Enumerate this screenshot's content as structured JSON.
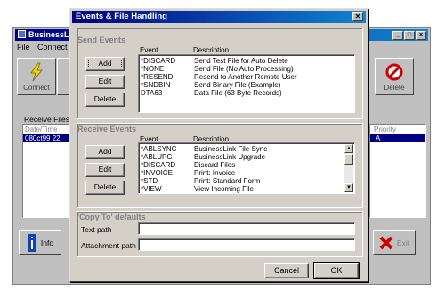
{
  "main_window": {
    "title": "BusinessLi",
    "menu": [
      "File",
      "Connect"
    ],
    "connect_label": "Connect",
    "delete_label": "Delete",
    "receive_files_label": "Receive Files",
    "date_time_header": "Date/Time",
    "priority_header": "Priority",
    "selected_row_date": "080ct99  22",
    "selected_row_priority": "A",
    "info_label": "Info",
    "exit_label": "Exit"
  },
  "dialog": {
    "title": "Events & File Handling",
    "close_glyph": "✕",
    "send_events": {
      "title": "Send Events",
      "col_event": "Event",
      "col_description": "Description",
      "buttons": {
        "add": "Add",
        "edit": "Edit",
        "delete": "Delete"
      },
      "rows": [
        {
          "event": "*DISCARD",
          "description": "Send Test File for Auto Delete"
        },
        {
          "event": "*NONE",
          "description": "Send File (No Auto Processing)"
        },
        {
          "event": "*RESEND",
          "description": "Resend to Another Remote User"
        },
        {
          "event": "*SNDBIN",
          "description": "Send Binary File (Example)"
        },
        {
          "event": "DTA63",
          "description": "Data File (63 Byte Records)"
        }
      ]
    },
    "receive_events": {
      "title": "Receive Events",
      "col_event": "Event",
      "col_description": "Description",
      "buttons": {
        "add": "Add",
        "edit": "Edit",
        "delete": "Delete"
      },
      "rows": [
        {
          "event": "*ABLSYNC",
          "description": "BusinessLink File Sync"
        },
        {
          "event": "*ABLUPG",
          "description": "BusinessLink Upgrade"
        },
        {
          "event": "*DISCARD",
          "description": "Discard Files"
        },
        {
          "event": "*INVOICE",
          "description": "Print: Invoice"
        },
        {
          "event": "*STD",
          "description": "Print: Standard Form"
        },
        {
          "event": "*VIEW",
          "description": "View Incoming File"
        }
      ]
    },
    "copy_to": {
      "title": "'Copy To' defaults",
      "text_path_label": "Text path",
      "text_path_value": "",
      "attachment_path_label": "Attachment path",
      "attachment_path_value": ""
    },
    "cancel_label": "Cancel",
    "ok_label": "OK"
  },
  "colors": {
    "titlebar_start": "#000080",
    "titlebar_end": "#1084d0",
    "face": "#d4d0c8",
    "selection": "#000080"
  }
}
